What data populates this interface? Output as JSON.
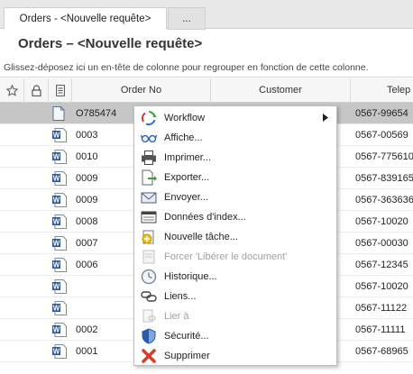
{
  "tabs": [
    {
      "label": "Orders - <Nouvelle requête>",
      "active": true
    },
    {
      "label": "...",
      "active": false
    }
  ],
  "page_title": "Orders – <Nouvelle requête>",
  "group_hint": "Glissez-déposez ici un en-tête de colonne pour regrouper en fonction de cette colonne.",
  "columns": {
    "star_icon": "star-icon",
    "lock_icon": "lock-icon",
    "doc_icon": "document-icon",
    "order_no": "Order No",
    "customer": "Customer",
    "telephone": "Telep"
  },
  "rows": [
    {
      "order_no": "O785474",
      "phone": "0567-99654",
      "icon": "generic-document-icon",
      "selected": true
    },
    {
      "order_no": "0003",
      "phone": "0567-00569",
      "icon": "word-document-icon",
      "selected": false
    },
    {
      "order_no": "0010",
      "phone": "0567-775610",
      "icon": "word-document-icon",
      "selected": false
    },
    {
      "order_no": "0009",
      "phone": "0567-839165",
      "icon": "word-document-icon",
      "selected": false
    },
    {
      "order_no": "0009",
      "phone": "0567-363636",
      "icon": "word-document-icon",
      "selected": false
    },
    {
      "order_no": "0008",
      "phone": "0567-10020",
      "icon": "word-document-icon",
      "selected": false
    },
    {
      "order_no": "0007",
      "phone": "0567-00030",
      "icon": "word-document-icon",
      "selected": false
    },
    {
      "order_no": "0006",
      "phone": "0567-12345",
      "icon": "word-document-icon",
      "selected": false
    },
    {
      "order_no": "",
      "phone": "0567-10020",
      "icon": "word-document-icon",
      "selected": false
    },
    {
      "order_no": "",
      "phone": "0567-11122",
      "icon": "word-document-icon",
      "selected": false
    },
    {
      "order_no": "0002",
      "phone": "0567-11111",
      "icon": "word-document-icon",
      "selected": false
    },
    {
      "order_no": "0001",
      "phone": "0567-68965",
      "icon": "word-document-icon",
      "selected": false
    }
  ],
  "context_menu": {
    "items": [
      {
        "label": "Workflow",
        "icon": "workflow-icon",
        "submenu": true,
        "enabled": true
      },
      {
        "label": "Affiche...",
        "icon": "glasses-icon",
        "enabled": true
      },
      {
        "label": "Imprimer...",
        "icon": "printer-icon",
        "enabled": true
      },
      {
        "label": "Exporter...",
        "icon": "export-icon",
        "enabled": true
      },
      {
        "label": "Envoyer...",
        "icon": "envelope-icon",
        "enabled": true
      },
      {
        "label": "Données d'index...",
        "icon": "index-data-icon",
        "enabled": true
      },
      {
        "label": "Nouvelle tâche...",
        "icon": "new-task-icon",
        "enabled": true
      },
      {
        "label": "Forcer 'Libérer le document'",
        "icon": "force-release-icon",
        "enabled": false
      },
      {
        "label": "Historique...",
        "icon": "history-clock-icon",
        "enabled": true
      },
      {
        "label": "Liens...",
        "icon": "links-icon",
        "enabled": true
      },
      {
        "label": "Lier à",
        "icon": "link-to-icon",
        "enabled": false
      },
      {
        "label": "Sécurité...",
        "icon": "shield-icon",
        "enabled": true
      },
      {
        "label": "Supprimer",
        "icon": "delete-icon",
        "enabled": true
      }
    ]
  },
  "colors": {
    "selected_row": "#c6c6c6",
    "word_blue": "#2b579a",
    "delete_red": "#d63a2a"
  }
}
